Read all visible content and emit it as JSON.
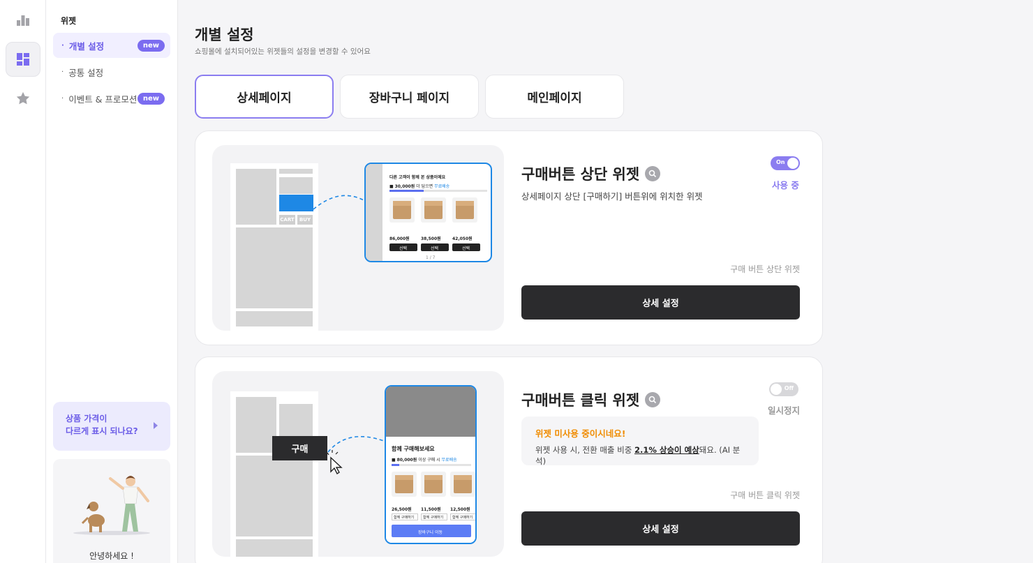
{
  "rail": {
    "items": [
      {
        "icon": "bar-chart-icon",
        "active": false
      },
      {
        "icon": "widget-grid-icon",
        "active": true
      },
      {
        "icon": "star-icon",
        "active": false
      }
    ]
  },
  "sidebar": {
    "section_title": "위젯",
    "items": [
      {
        "label": "개별 설정",
        "badge": "new",
        "active": true
      },
      {
        "label": "공통 설정",
        "badge": "",
        "active": false
      },
      {
        "label": "이벤트 & 프로모션",
        "badge": "new",
        "active": false
      }
    ],
    "promo": {
      "line1": "상품 가격이",
      "line2": "다르게 표시 되나요?"
    },
    "greeting": "안녕하세요 !"
  },
  "header": {
    "title": "개별 설정",
    "subtitle": "쇼핑몰에 설치되어있는 위젯들의 설정을 변경할 수 있어요"
  },
  "tabs": [
    {
      "label": "상세페이지",
      "active": true
    },
    {
      "label": "장바구니 페이지",
      "active": false
    },
    {
      "label": "메인페이지",
      "active": false
    }
  ],
  "widgets": [
    {
      "title": "구매버튼 상단 위젯",
      "description": "상세페이지 상단 [구매하기] 버튼위에 위치한 위젯",
      "toggle": "On",
      "status": "사용 중",
      "caption": "구매 버튼 상단 위젯",
      "button": "상세 설정",
      "preview": {
        "cart": "CART",
        "buy": "BUY",
        "heading": "다른 고객이 함께 본 상품이에요",
        "shipping_amount": "30,000원",
        "shipping_rest": "더 담으면",
        "shipping_free": "무료배송",
        "prices": [
          "86,000원",
          "38,500원",
          "42,050원"
        ],
        "select": "선택",
        "pager": "1 / 7"
      }
    },
    {
      "title": "구매버튼 클릭 위젯",
      "warning_title": "위젯 미사용 중이시네요!",
      "warning_prefix": "위젯 사용 시, 전환 매출 비중 ",
      "warning_highlight": "2.1% 상승이 예상",
      "warning_suffix": "돼요. (AI 분석)",
      "toggle": "Off",
      "status": "일시정지",
      "caption": "구매 버튼 클릭 위젯",
      "button": "상세 설정",
      "preview": {
        "buy": "구매",
        "heading": "함께 구매해보세요",
        "shipping_amount": "80,000원",
        "shipping_rest": "이상 구매 시",
        "shipping_free": "무료배송",
        "prices": [
          "26,500원",
          "11,500원",
          "12,500원"
        ],
        "add": "함께 구매하기",
        "cta": "장바구니 이동"
      }
    }
  ],
  "colors": {
    "accent": "#8b7df0",
    "warning": "#f08c00",
    "preview_border": "#1e88e5"
  }
}
